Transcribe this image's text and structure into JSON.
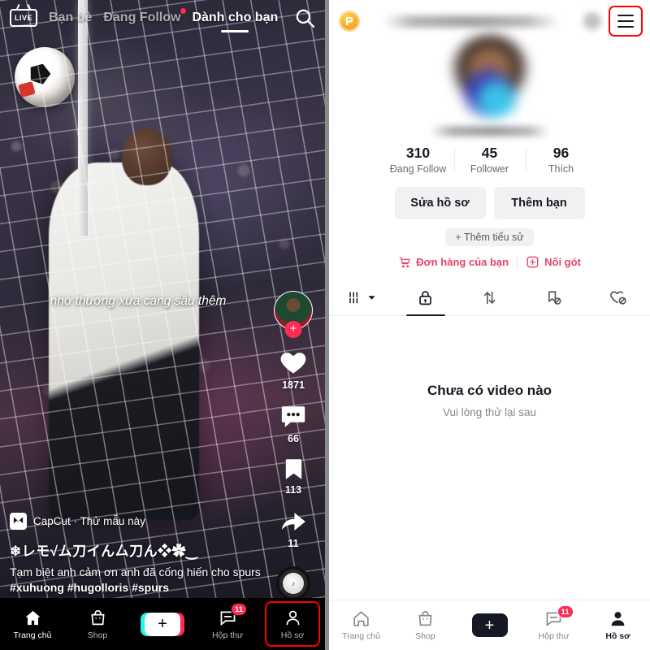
{
  "theme": {
    "accent_pink": "#fe2c55",
    "accent_cyan": "#25f4ee",
    "link_pink": "#e8426a",
    "highlight_red": "#ff0000",
    "text_dark": "#161823",
    "text_muted": "#86868e",
    "page_bg": "#888a8c"
  },
  "feed": {
    "topbar": {
      "live_label": "LIVE",
      "tabs": [
        {
          "label": "Bạn bè",
          "active": false,
          "dot": false
        },
        {
          "label": "Đang Follow",
          "active": false,
          "dot": true
        },
        {
          "label": "Dành cho bạn",
          "active": true,
          "dot": false
        }
      ],
      "search_icon": "search-icon"
    },
    "subtitle": "nhớ thương xưa càng sầu thêm",
    "actions": {
      "follow_plus": "+",
      "like_count": "1871",
      "comment_count": "66",
      "bookmark_count": "113",
      "share_count": "11",
      "music_disc": "♪"
    },
    "caption": {
      "capcut_label": "CapCut · Thử mẫu này",
      "username": "❄︎レモ√ム刀イん厶刀ん❖✿‿",
      "text_plain": "Tạm biệt anh cảm ơn anh đã cống hiến cho spurs ",
      "hashtags": "#xuhuong #hugolloris #spurs"
    },
    "bottom_nav": {
      "items": [
        {
          "label": "Trang chủ",
          "icon": "home-icon",
          "active": true,
          "badge": ""
        },
        {
          "label": "Shop",
          "icon": "shop-bag-icon",
          "active": false,
          "badge": ""
        },
        {
          "label": "",
          "icon": "create-plus-icon",
          "active": false,
          "badge": ""
        },
        {
          "label": "Hộp thư",
          "icon": "inbox-message-icon",
          "active": false,
          "badge": "11"
        },
        {
          "label": "Hồ sơ",
          "icon": "profile-person-icon",
          "active": false,
          "badge": "",
          "highlighted": true
        }
      ],
      "create_label": "+"
    }
  },
  "profile": {
    "topbar": {
      "badge_letter": "P",
      "title_blurred": "",
      "menu_icon": "hamburger-menu-icon",
      "menu_highlighted": true
    },
    "stats": [
      {
        "value": "310",
        "label": "Đang Follow"
      },
      {
        "value": "45",
        "label": "Follower"
      },
      {
        "value": "96",
        "label": "Thích"
      }
    ],
    "actions": {
      "edit_profile": "Sửa hồ sơ",
      "add_friend": "Thêm bạn"
    },
    "bio_chip": "+ Thêm tiểu sử",
    "links": [
      {
        "label": "Đơn hàng của bạn",
        "icon": "shopping-cart-icon"
      },
      {
        "label": "Nối gót",
        "icon": "add-box-icon"
      }
    ],
    "tabs": [
      {
        "icon": "playlist-grid-icon",
        "active": false,
        "has_chevron": true
      },
      {
        "icon": "lock-icon",
        "active": true,
        "has_chevron": false
      },
      {
        "icon": "repost-arrows-icon",
        "active": false,
        "has_chevron": false
      },
      {
        "icon": "bookmark-private-icon",
        "active": false,
        "has_chevron": false
      },
      {
        "icon": "heart-private-icon",
        "active": false,
        "has_chevron": false
      }
    ],
    "empty_state": {
      "title": "Chưa có video nào",
      "subtitle": "Vui lòng thử lại sau"
    },
    "bottom_nav": {
      "items": [
        {
          "label": "Trang chủ",
          "icon": "home-icon",
          "active": false,
          "badge": ""
        },
        {
          "label": "Shop",
          "icon": "shop-bag-icon",
          "active": false,
          "badge": ""
        },
        {
          "label": "",
          "icon": "create-plus-icon",
          "active": false,
          "badge": ""
        },
        {
          "label": "Hộp thư",
          "icon": "inbox-message-icon",
          "active": false,
          "badge": "11"
        },
        {
          "label": "Hồ sơ",
          "icon": "profile-person-icon",
          "active": true,
          "badge": ""
        }
      ],
      "create_label": "+"
    }
  }
}
